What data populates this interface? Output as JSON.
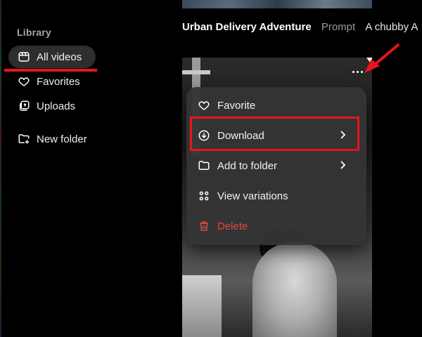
{
  "sidebar": {
    "heading": "Library",
    "items": [
      {
        "label": "All videos",
        "icon": "video-library-icon",
        "active": true
      },
      {
        "label": "Favorites",
        "icon": "heart-icon",
        "active": false
      },
      {
        "label": "Uploads",
        "icon": "uploads-icon",
        "active": false
      }
    ],
    "new_folder": {
      "label": "New folder",
      "icon": "new-folder-icon"
    }
  },
  "video": {
    "title": "Urban Delivery Adventure",
    "prompt_label": "Prompt",
    "prompt_text": "A chubby A"
  },
  "menu": {
    "items": [
      {
        "label": "Favorite",
        "icon": "heart-icon"
      },
      {
        "label": "Download",
        "icon": "download-icon",
        "has_submenu": true
      },
      {
        "label": "Add to folder",
        "icon": "folder-icon",
        "has_submenu": true
      },
      {
        "label": "View variations",
        "icon": "grid-icon"
      },
      {
        "label": "Delete",
        "icon": "trash-icon",
        "danger": true
      }
    ]
  },
  "colors": {
    "annotation_red": "#e8141b",
    "danger": "#e04848",
    "menu_bg": "#343434",
    "active_nav_bg": "#2e2e2e"
  }
}
